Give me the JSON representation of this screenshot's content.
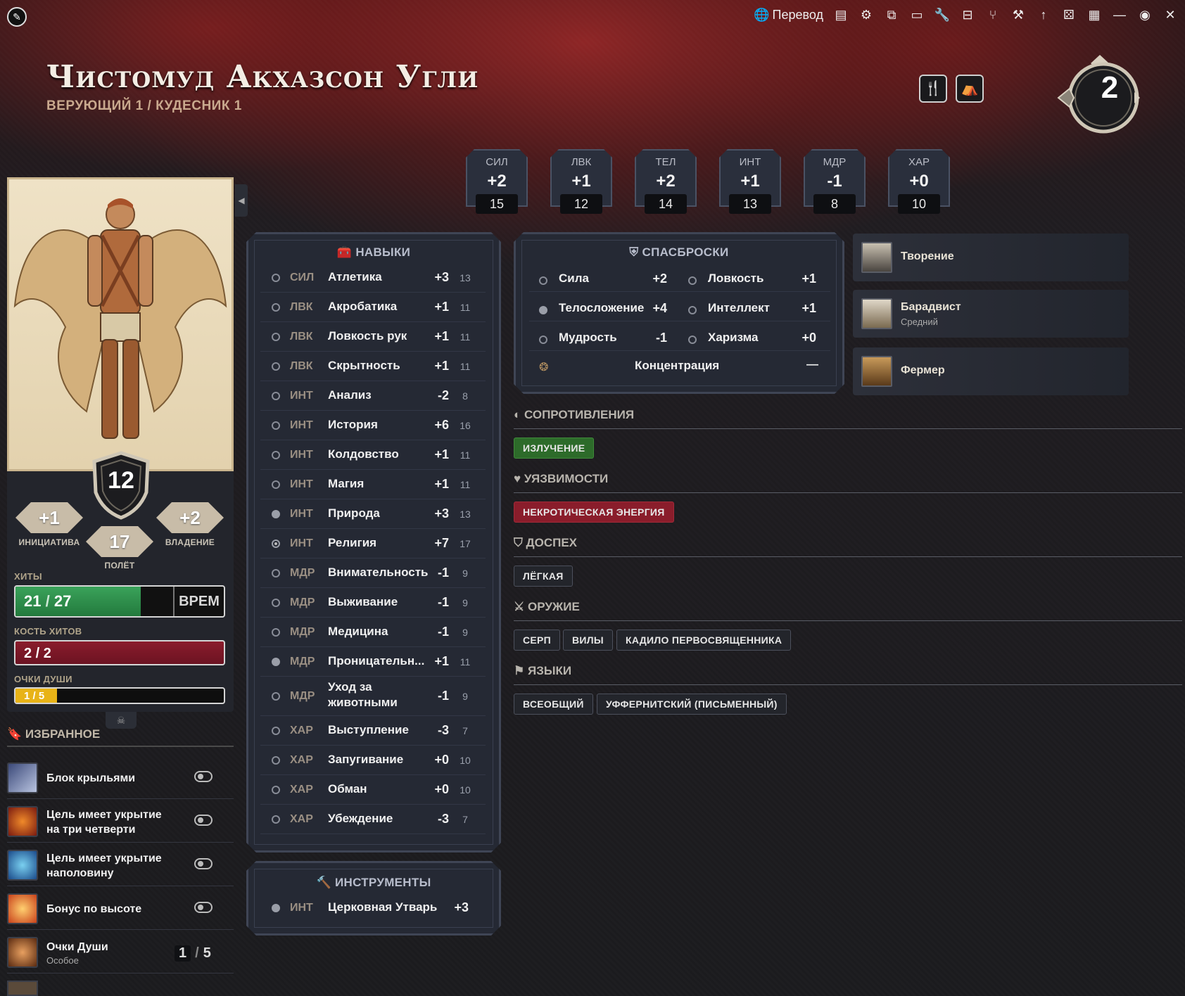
{
  "topbar": {
    "translate_label": "Перевод",
    "icons": [
      "compass-icon",
      "globe-icon",
      "journal-icon",
      "gear-icon",
      "share-icon",
      "chest-icon",
      "wrench-icon",
      "sheet-icon",
      "branch-icon",
      "hammer-icon",
      "arrow-up-icon",
      "dice-icon",
      "grid-icon",
      "minimize-icon",
      "user-icon",
      "close-icon"
    ]
  },
  "character": {
    "name": "Чистомуд Акхазсон Угли",
    "class_line": "ВЕРУЮЩИЙ 1 / КУДЕСНИК 1",
    "level": "2"
  },
  "abilities": [
    {
      "abbr": "СИЛ",
      "mod": "+2",
      "score": "15"
    },
    {
      "abbr": "ЛВК",
      "mod": "+1",
      "score": "12"
    },
    {
      "abbr": "ТЕЛ",
      "mod": "+2",
      "score": "14"
    },
    {
      "abbr": "ИНТ",
      "mod": "+1",
      "score": "13"
    },
    {
      "abbr": "МДР",
      "mod": "-1",
      "score": "8"
    },
    {
      "abbr": "ХАР",
      "mod": "+0",
      "score": "10"
    }
  ],
  "stats": {
    "ac": "12",
    "initiative": "+1",
    "initiative_label": "ИНИЦИАТИВА",
    "proficiency": "+2",
    "proficiency_label": "ВЛАДЕНИЕ",
    "speed": "17",
    "speed_label": "ПОЛЁТ"
  },
  "hp": {
    "label": "ХИТЫ",
    "current": "21",
    "sep": "/",
    "max": "27",
    "fraction": 0.78,
    "temp_label": "ВРЕМ"
  },
  "hit_dice": {
    "label": "КОСТЬ ХИТОВ",
    "value": "2 / 2"
  },
  "soul_points": {
    "label": "ОЧКИ ДУШИ",
    "value": "1 / 5",
    "fraction": 0.2
  },
  "favorites": {
    "title": "ИЗБРАННОЕ",
    "items": [
      {
        "name": "Блок крыльями",
        "type": "toggle"
      },
      {
        "name": "Цель имеет укрытие на три четверти",
        "type": "toggle"
      },
      {
        "name": "Цель имеет укрытие наполовину",
        "type": "toggle"
      },
      {
        "name": "Бонус по высоте",
        "type": "toggle"
      },
      {
        "name": "Очки Души",
        "sub": "Особое",
        "type": "uses",
        "current": "1",
        "max": "5"
      }
    ]
  },
  "skills": {
    "title": "НАВЫКИ",
    "rows": [
      {
        "prof": "none",
        "abbr": "СИЛ",
        "name": "Атлетика",
        "mod": "+3",
        "passive": "13"
      },
      {
        "prof": "none",
        "abbr": "ЛВК",
        "name": "Акробатика",
        "mod": "+1",
        "passive": "11"
      },
      {
        "prof": "none",
        "abbr": "ЛВК",
        "name": "Ловкость рук",
        "mod": "+1",
        "passive": "11"
      },
      {
        "prof": "none",
        "abbr": "ЛВК",
        "name": "Скрытность",
        "mod": "+1",
        "passive": "11"
      },
      {
        "prof": "none",
        "abbr": "ИНТ",
        "name": "Анализ",
        "mod": "-2",
        "passive": "8"
      },
      {
        "prof": "none",
        "abbr": "ИНТ",
        "name": "История",
        "mod": "+6",
        "passive": "16"
      },
      {
        "prof": "none",
        "abbr": "ИНТ",
        "name": "Колдовство",
        "mod": "+1",
        "passive": "11"
      },
      {
        "prof": "none",
        "abbr": "ИНТ",
        "name": "Магия",
        "mod": "+1",
        "passive": "11"
      },
      {
        "prof": "prof",
        "abbr": "ИНТ",
        "name": "Природа",
        "mod": "+3",
        "passive": "13"
      },
      {
        "prof": "exp",
        "abbr": "ИНТ",
        "name": "Религия",
        "mod": "+7",
        "passive": "17"
      },
      {
        "prof": "none",
        "abbr": "МДР",
        "name": "Внимательность",
        "mod": "-1",
        "passive": "9"
      },
      {
        "prof": "none",
        "abbr": "МДР",
        "name": "Выживание",
        "mod": "-1",
        "passive": "9"
      },
      {
        "prof": "none",
        "abbr": "МДР",
        "name": "Медицина",
        "mod": "-1",
        "passive": "9"
      },
      {
        "prof": "prof",
        "abbr": "МДР",
        "name": "Проницательн...",
        "mod": "+1",
        "passive": "11"
      },
      {
        "prof": "none",
        "abbr": "МДР",
        "name": "Уход за животными",
        "mod": "-1",
        "passive": "9"
      },
      {
        "prof": "none",
        "abbr": "ХАР",
        "name": "Выступление",
        "mod": "-3",
        "passive": "7"
      },
      {
        "prof": "none",
        "abbr": "ХАР",
        "name": "Запугивание",
        "mod": "+0",
        "passive": "10"
      },
      {
        "prof": "none",
        "abbr": "ХАР",
        "name": "Обман",
        "mod": "+0",
        "passive": "10"
      },
      {
        "prof": "none",
        "abbr": "ХАР",
        "name": "Убеждение",
        "mod": "-3",
        "passive": "7"
      }
    ]
  },
  "tools": {
    "title": "ИНСТРУМЕНТЫ",
    "rows": [
      {
        "prof": "prof",
        "abbr": "ИНТ",
        "name": "Церковная Утварь",
        "mod": "+3"
      }
    ]
  },
  "saves": {
    "title": "СПАСБРОСКИ",
    "items": [
      {
        "prof": "none",
        "name": "Сила",
        "mod": "+2"
      },
      {
        "prof": "none",
        "name": "Ловкость",
        "mod": "+1"
      },
      {
        "prof": "prof",
        "name": "Телосложение",
        "mod": "+4"
      },
      {
        "prof": "none",
        "name": "Интеллект",
        "mod": "+1"
      },
      {
        "prof": "none",
        "name": "Мудрость",
        "mod": "-1"
      },
      {
        "prof": "none",
        "name": "Харизма",
        "mod": "+0"
      }
    ],
    "concentration_label": "Концентрация",
    "concentration_value": "—"
  },
  "side_list": [
    {
      "name": "Творение",
      "sub": ""
    },
    {
      "name": "Барадвист",
      "sub": "Средний"
    },
    {
      "name": "Фермер",
      "sub": ""
    }
  ],
  "traits": {
    "resistances": {
      "title": "СОПРОТИВЛЕНИЯ",
      "tags": [
        "ИЗЛУЧЕНИЕ"
      ]
    },
    "vulnerabilities": {
      "title": "УЯЗВИМОСТИ",
      "tags": [
        "НЕКРОТИЧЕСКАЯ ЭНЕРГИЯ"
      ]
    },
    "armor": {
      "title": "ДОСПЕХ",
      "tags": [
        "ЛЁГКАЯ"
      ]
    },
    "weapons": {
      "title": "ОРУЖИЕ",
      "tags": [
        "СЕРП",
        "ВИЛЫ",
        "КАДИЛО ПЕРВОСВЯЩЕННИКА"
      ]
    },
    "languages": {
      "title": "ЯЗЫКИ",
      "tags": [
        "ВСЕОБЩИЙ",
        "УФФЕРНИТСКИЙ (ПИСЬМЕННЫЙ)"
      ]
    }
  },
  "colors": {
    "hp_green": "#2f8f4a",
    "hit_dice_red": "#7c1827",
    "soul_yellow": "#e8b317",
    "resist_green": "#2d6b2a",
    "vuln_red": "#8a1d2b"
  }
}
